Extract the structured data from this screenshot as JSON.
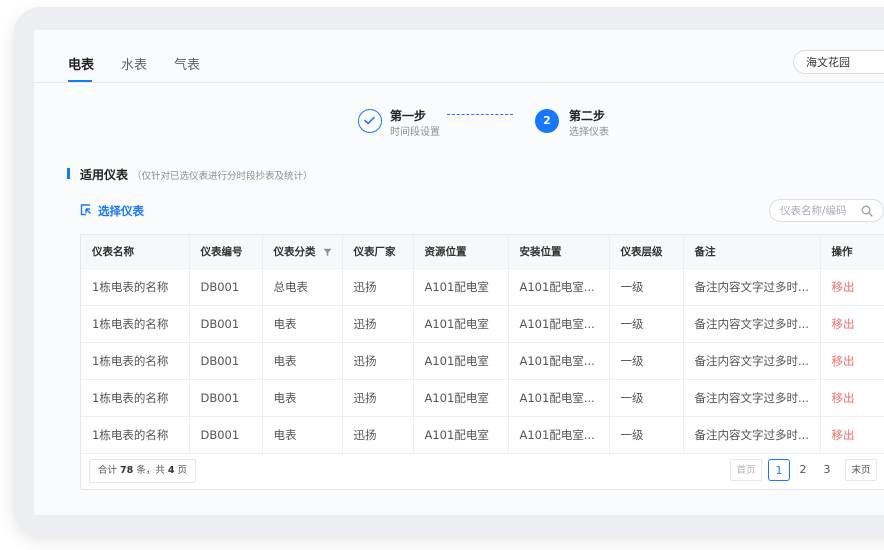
{
  "tabs": [
    {
      "label": "电表",
      "active": true
    },
    {
      "label": "水表",
      "active": false
    },
    {
      "label": "气表",
      "active": false
    }
  ],
  "location_select": {
    "value": "海文花园"
  },
  "steps": [
    {
      "title": "第一步",
      "subtitle": "时间段设置",
      "status": "done"
    },
    {
      "number": "2",
      "title": "第二步",
      "subtitle": "选择仪表",
      "status": "current"
    }
  ],
  "section": {
    "title": "适用仪表",
    "note": "（仅针对已选仪表进行分时段抄表及统计）"
  },
  "choose_button": {
    "label": "选择仪表"
  },
  "search": {
    "placeholder": "仪表名称/编码"
  },
  "table": {
    "headers": [
      "仪表名称",
      "仪表编号",
      "仪表分类",
      "仪表厂家",
      "资源位置",
      "安装位置",
      "仪表层级",
      "备注",
      "操作"
    ],
    "rows": [
      [
        "1栋电表的名称",
        "DB001",
        "总电表",
        "迅扬",
        "A101配电室",
        "A101配电室...",
        "一级",
        "备注内容文字过多时...",
        "移出"
      ],
      [
        "1栋电表的名称",
        "DB001",
        "电表",
        "迅扬",
        "A101配电室",
        "A101配电室...",
        "一级",
        "备注内容文字过多时...",
        "移出"
      ],
      [
        "1栋电表的名称",
        "DB001",
        "电表",
        "迅扬",
        "A101配电室",
        "A101配电室...",
        "一级",
        "备注内容文字过多时...",
        "移出"
      ],
      [
        "1栋电表的名称",
        "DB001",
        "电表",
        "迅扬",
        "A101配电室",
        "A101配电室...",
        "一级",
        "备注内容文字过多时...",
        "移出"
      ],
      [
        "1栋电表的名称",
        "DB001",
        "电表",
        "迅扬",
        "A101配电室",
        "A101配电室...",
        "一级",
        "备注内容文字过多时...",
        "移出"
      ]
    ]
  },
  "pagination": {
    "total_prefix": "合计",
    "total_count": "78",
    "total_mid": "条，共",
    "total_pages": "4",
    "total_suffix": "页",
    "first_label": "首页",
    "pages": [
      "1",
      "2",
      "3"
    ],
    "current_page": "1",
    "last_label": "末页"
  },
  "colors": {
    "accent": "#1677ff",
    "danger": "#f56c6c"
  }
}
